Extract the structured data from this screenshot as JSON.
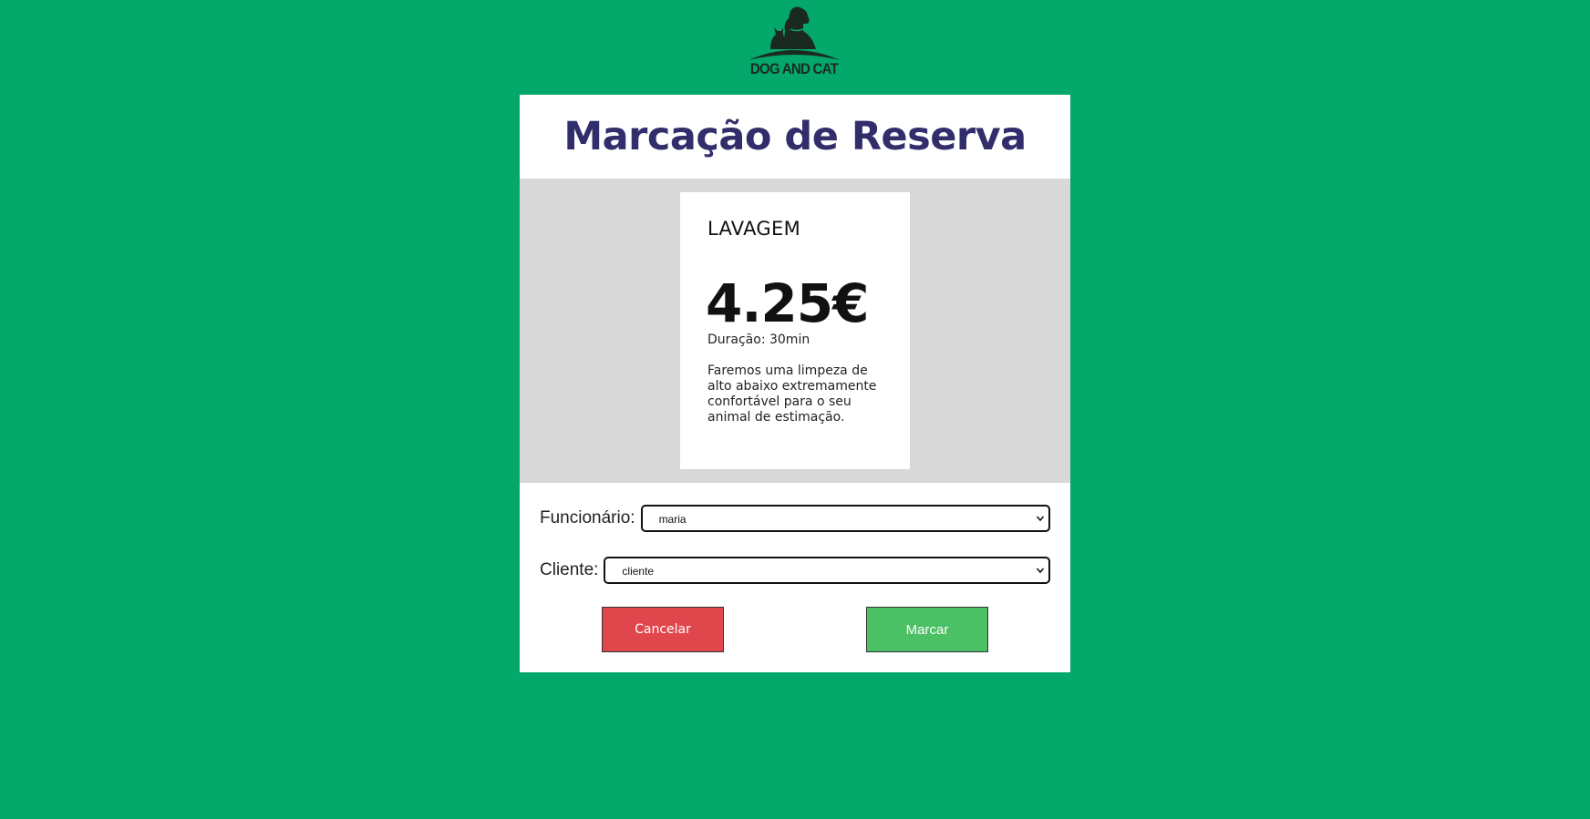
{
  "brand": {
    "logo_text": "DOG AND CAT",
    "logo_icon": "dog-and-cat-logo-icon"
  },
  "header": {
    "title": "Marcação de Reserva"
  },
  "service": {
    "name": "LAVAGEM",
    "price": "4.25€",
    "duration": "Duração: 30min",
    "description": "Faremos uma limpeza de alto abaixo extremamente confortável para o seu animal de estimação."
  },
  "form": {
    "employee_label": "Funcionário:",
    "employee_value": "maria",
    "client_label": "Cliente:",
    "client_value": "cliente"
  },
  "actions": {
    "cancel_label": "Cancelar",
    "confirm_label": "Marcar"
  },
  "colors": {
    "background": "#04a86b",
    "title": "#322d6b",
    "cancel": "#e0474c",
    "confirm": "#4bc065",
    "service_area": "#d8d8d8"
  }
}
